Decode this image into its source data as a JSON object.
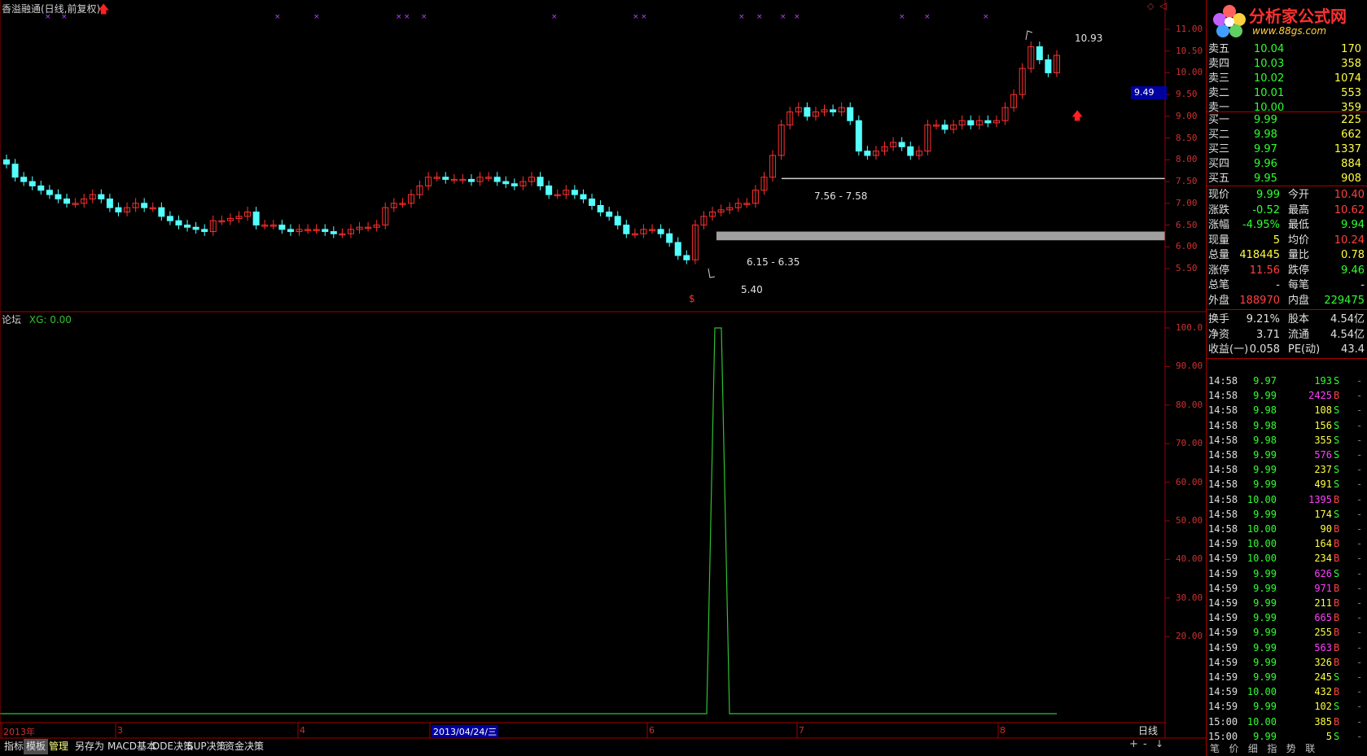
{
  "header": {
    "title": "香溢融通(日线,前复权)"
  },
  "price_axis": [
    "11.00",
    "10.50",
    "10.00",
    "9.50",
    "9.00",
    "8.50",
    "8.00",
    "7.50",
    "7.00",
    "6.50",
    "6.00",
    "5.50"
  ],
  "current_price_tag": "9.49",
  "annotations": {
    "high": "10.93",
    "low": "5.40",
    "zone_upper": "7.56 - 7.58",
    "zone_lower": "6.15 - 6.35",
    "dollar_marker": "$"
  },
  "indicator": {
    "name": "论坛",
    "value_label": "XG: 0.00",
    "axis": [
      "100.0",
      "90.00",
      "80.00",
      "70.00",
      "60.00",
      "50.00",
      "40.00",
      "30.00",
      "20.00"
    ]
  },
  "date_axis": {
    "labels": [
      "2013年",
      "3",
      "4",
      "2013/04/24/三",
      "6",
      "7",
      "8"
    ],
    "period": "日线"
  },
  "toolbar": {
    "tabs": [
      "指标",
      "模板",
      "管理",
      "另存为",
      "MACD基本",
      "DDE决策",
      "SUP决策",
      "资金决策"
    ]
  },
  "logo": {
    "name": "分析家公式网",
    "url": "www.88gs.com"
  },
  "order_book": {
    "asks": [
      {
        "label": "卖五",
        "price": "10.04",
        "vol": "170"
      },
      {
        "label": "卖四",
        "price": "10.03",
        "vol": "358"
      },
      {
        "label": "卖三",
        "price": "10.02",
        "vol": "1074"
      },
      {
        "label": "卖二",
        "price": "10.01",
        "vol": "553"
      },
      {
        "label": "卖一",
        "price": "10.00",
        "vol": "359"
      }
    ],
    "bids": [
      {
        "label": "买一",
        "price": "9.99",
        "vol": "225"
      },
      {
        "label": "买二",
        "price": "9.98",
        "vol": "662"
      },
      {
        "label": "买三",
        "price": "9.97",
        "vol": "1337"
      },
      {
        "label": "买四",
        "price": "9.96",
        "vol": "884"
      },
      {
        "label": "买五",
        "price": "9.95",
        "vol": "908"
      }
    ]
  },
  "stats": [
    {
      "l1": "现价",
      "v1": "9.99",
      "c1": "green",
      "l2": "今开",
      "v2": "10.40",
      "c2": "red"
    },
    {
      "l1": "涨跌",
      "v1": "-0.52",
      "c1": "green",
      "l2": "最高",
      "v2": "10.62",
      "c2": "red"
    },
    {
      "l1": "涨幅",
      "v1": "-4.95%",
      "c1": "green",
      "l2": "最低",
      "v2": "9.94",
      "c2": "green"
    },
    {
      "l1": "现量",
      "v1": "5",
      "c1": "yellow",
      "l2": "均价",
      "v2": "10.24",
      "c2": "red"
    },
    {
      "l1": "总量",
      "v1": "418445",
      "c1": "yellow",
      "l2": "量比",
      "v2": "0.78",
      "c2": "yellow"
    },
    {
      "l1": "涨停",
      "v1": "11.56",
      "c1": "red",
      "l2": "跌停",
      "v2": "9.46",
      "c2": "green"
    },
    {
      "l1": "总笔",
      "v1": "-",
      "c1": "white",
      "l2": "每笔",
      "v2": "-",
      "c2": "white"
    },
    {
      "l1": "外盘",
      "v1": "188970",
      "c1": "red",
      "l2": "内盘",
      "v2": "229475",
      "c2": "green"
    }
  ],
  "fundamentals": [
    {
      "l1": "换手",
      "v1": "9.21%",
      "l2": "股本",
      "v2": "4.54亿"
    },
    {
      "l1": "净资",
      "v1": "3.71",
      "l2": "流通",
      "v2": "4.54亿"
    },
    {
      "l1": "收益(一)",
      "v1": "0.058",
      "l2": "PE(动)",
      "v2": "43.4"
    }
  ],
  "ticks": [
    {
      "t": "14:58",
      "p": "9.97",
      "v": "193",
      "s": "S",
      "vc": "green"
    },
    {
      "t": "14:58",
      "p": "9.99",
      "v": "2425",
      "s": "B",
      "vc": "mag"
    },
    {
      "t": "14:58",
      "p": "9.98",
      "v": "108",
      "s": "S",
      "vc": "yellow"
    },
    {
      "t": "14:58",
      "p": "9.98",
      "v": "156",
      "s": "S",
      "vc": "yellow"
    },
    {
      "t": "14:58",
      "p": "9.98",
      "v": "355",
      "s": "S",
      "vc": "yellow"
    },
    {
      "t": "14:58",
      "p": "9.99",
      "v": "576",
      "s": "S",
      "vc": "mag"
    },
    {
      "t": "14:58",
      "p": "9.99",
      "v": "237",
      "s": "S",
      "vc": "yellow"
    },
    {
      "t": "14:58",
      "p": "9.99",
      "v": "491",
      "s": "S",
      "vc": "yellow"
    },
    {
      "t": "14:58",
      "p": "10.00",
      "v": "1395",
      "s": "B",
      "vc": "mag"
    },
    {
      "t": "14:58",
      "p": "9.99",
      "v": "174",
      "s": "S",
      "vc": "yellow"
    },
    {
      "t": "14:58",
      "p": "10.00",
      "v": "90",
      "s": "B",
      "vc": "yellow"
    },
    {
      "t": "14:59",
      "p": "10.00",
      "v": "164",
      "s": "B",
      "vc": "yellow"
    },
    {
      "t": "14:59",
      "p": "10.00",
      "v": "234",
      "s": "B",
      "vc": "yellow"
    },
    {
      "t": "14:59",
      "p": "9.99",
      "v": "626",
      "s": "S",
      "vc": "mag"
    },
    {
      "t": "14:59",
      "p": "9.99",
      "v": "971",
      "s": "B",
      "vc": "mag"
    },
    {
      "t": "14:59",
      "p": "9.99",
      "v": "211",
      "s": "B",
      "vc": "yellow"
    },
    {
      "t": "14:59",
      "p": "9.99",
      "v": "665",
      "s": "B",
      "vc": "mag"
    },
    {
      "t": "14:59",
      "p": "9.99",
      "v": "255",
      "s": "B",
      "vc": "yellow"
    },
    {
      "t": "14:59",
      "p": "9.99",
      "v": "563",
      "s": "B",
      "vc": "mag"
    },
    {
      "t": "14:59",
      "p": "9.99",
      "v": "326",
      "s": "B",
      "vc": "yellow"
    },
    {
      "t": "14:59",
      "p": "9.99",
      "v": "245",
      "s": "S",
      "vc": "yellow"
    },
    {
      "t": "14:59",
      "p": "10.00",
      "v": "432",
      "s": "B",
      "vc": "yellow"
    },
    {
      "t": "14:59",
      "p": "9.99",
      "v": "102",
      "s": "S",
      "vc": "yellow"
    },
    {
      "t": "15:00",
      "p": "10.00",
      "v": "385",
      "s": "B",
      "vc": "yellow"
    },
    {
      "t": "15:00",
      "p": "9.99",
      "v": "5",
      "s": "S",
      "vc": "yellow"
    }
  ],
  "colors": {
    "up": "#ff3030",
    "down": "#54ffff",
    "grid": "#a00000",
    "xg_line": "#30c030"
  }
}
